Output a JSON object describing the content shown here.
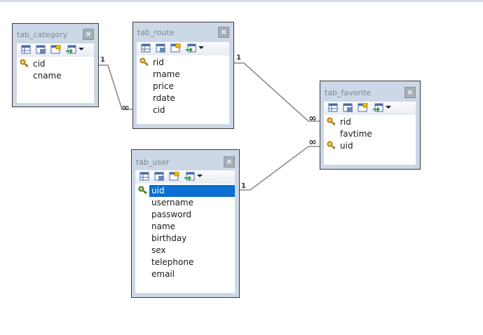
{
  "tables": [
    {
      "name": "tab_category",
      "fields": [
        {
          "label": "cid",
          "key": true
        },
        {
          "label": "cname"
        }
      ]
    },
    {
      "name": "tab_route",
      "fields": [
        {
          "label": "rid",
          "key": true
        },
        {
          "label": "rname"
        },
        {
          "label": "price"
        },
        {
          "label": "rdate"
        },
        {
          "label": "cid"
        }
      ]
    },
    {
      "name": "tab_favorite",
      "fields": [
        {
          "label": "rid",
          "key": true
        },
        {
          "label": "favtime"
        },
        {
          "label": "uid",
          "key": true
        }
      ]
    },
    {
      "name": "tab_user",
      "fields": [
        {
          "label": "uid",
          "key": true,
          "selected": true
        },
        {
          "label": "username"
        },
        {
          "label": "password"
        },
        {
          "label": "name"
        },
        {
          "label": "birthday"
        },
        {
          "label": "sex"
        },
        {
          "label": "telephone"
        },
        {
          "label": "email"
        }
      ]
    }
  ],
  "relations": [
    {
      "from": "tab_category",
      "to": "tab_route",
      "one": "1",
      "many": "∞"
    },
    {
      "from": "tab_route",
      "to": "tab_favorite",
      "one": "1",
      "many": "∞"
    },
    {
      "from": "tab_user",
      "to": "tab_favorite",
      "one": "1",
      "many": "∞"
    }
  ],
  "toolbar": {
    "icons": [
      "edit-table-icon",
      "view-table-icon",
      "lock-table-icon",
      "import-icon",
      "dropdown-arrow-icon"
    ]
  },
  "icons": {
    "key": "key-icon",
    "close": "close-icon"
  },
  "colors": {
    "selection": "#0a6fd0",
    "window": "#ccd8e6",
    "relation_line": "#8a8a8a",
    "key_gold": "#d8a21a"
  }
}
